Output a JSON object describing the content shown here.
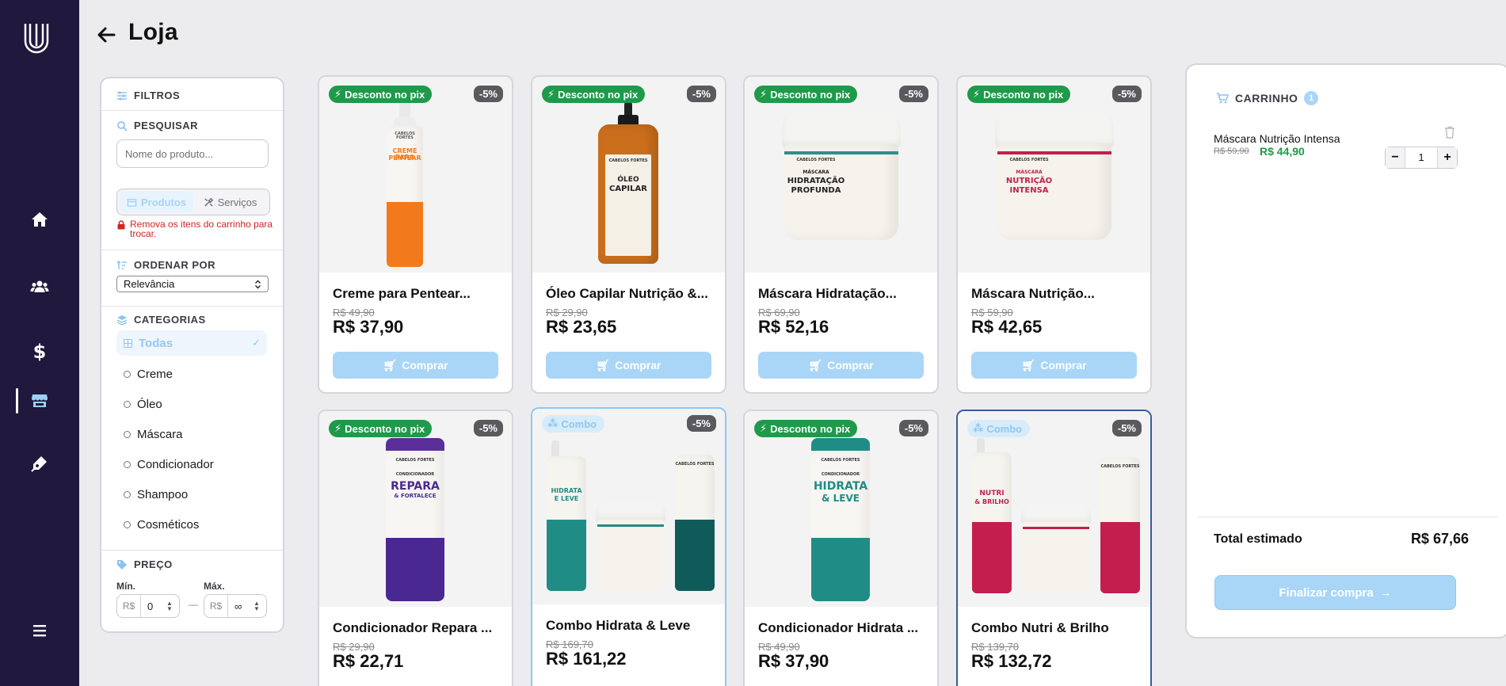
{
  "header": {
    "title": "Loja"
  },
  "sidebar": {
    "items": [
      {
        "name": "home",
        "icon": "home-icon"
      },
      {
        "name": "users",
        "icon": "users-icon"
      },
      {
        "name": "finance",
        "icon": "dollar-icon",
        "glyph": "$"
      },
      {
        "name": "store",
        "icon": "store-icon",
        "active": true
      },
      {
        "name": "tools",
        "icon": "pen-icon"
      },
      {
        "name": "menu",
        "icon": "menu-icon"
      }
    ]
  },
  "filters": {
    "title": "FILTROS",
    "search_title": "PESQUISAR",
    "search_placeholder": "Nome do produto...",
    "toggle": {
      "products": "Produtos",
      "services": "Serviços",
      "selected": "Produtos"
    },
    "warning": "Remova os itens do carrinho para trocar.",
    "sort_title": "ORDENAR POR",
    "sort_value": "Relevância",
    "categories_title": "CATEGORIAS",
    "categories": [
      "Todas",
      "Creme",
      "Óleo",
      "Máscara",
      "Condicionador",
      "Shampoo",
      "Cosméticos"
    ],
    "active_category": "Todas",
    "price_title": "PREÇO",
    "min_label": "Mín.",
    "max_label": "Máx.",
    "currency": "R$",
    "min_value": "0",
    "max_value": "∞",
    "range_sep": "—"
  },
  "products": [
    {
      "name": "Creme para Pentear...",
      "old_price": "R$ 49,90",
      "price": "R$ 37,90",
      "badge": "Desconto no pix",
      "discount": "-5%",
      "buy": "Comprar"
    },
    {
      "name": "Óleo Capilar Nutrição &...",
      "old_price": "R$ 29,90",
      "price": "R$ 23,65",
      "badge": "Desconto no pix",
      "discount": "-5%",
      "buy": "Comprar"
    },
    {
      "name": "Máscara Hidratação...",
      "old_price": "R$ 69,90",
      "price": "R$ 52,16",
      "badge": "Desconto no pix",
      "discount": "-5%",
      "buy": "Comprar"
    },
    {
      "name": "Máscara Nutrição...",
      "old_price": "R$ 59,90",
      "price": "R$ 42,65",
      "badge": "Desconto no pix",
      "discount": "-5%",
      "buy": "Comprar"
    },
    {
      "name": "Condicionador Repara ...",
      "old_price": "R$ 29,90",
      "price": "R$ 22,71",
      "badge": "Desconto no pix",
      "discount": "-5%"
    },
    {
      "name": "Combo Hidrata & Leve",
      "old_price": "R$ 169,70",
      "price": "R$ 161,22",
      "badge": "Combo",
      "discount": "-5%"
    },
    {
      "name": "Condicionador Hidrata ...",
      "old_price": "R$ 49,90",
      "price": "R$ 37,90",
      "badge": "Desconto no pix",
      "discount": "-5%"
    },
    {
      "name": "Combo Nutri & Brilho",
      "old_price": "R$ 139,70",
      "price": "R$ 132,72",
      "badge": "Combo",
      "discount": "-5%"
    }
  ],
  "cart": {
    "title": "CARRINHO",
    "count": "1",
    "item": {
      "name": "Máscara Nutrição Intensa",
      "old_price": "R$ 59,90",
      "price": "R$ 44,90",
      "qty": "1",
      "minus": "−",
      "plus": "+"
    },
    "total_label": "Total estimado",
    "total_value": "R$ 67,66",
    "checkout": "Finalizar compra"
  },
  "label_texts": {
    "p1": {
      "brand": "CABELOS FORTES",
      "line1": "CREME PARA",
      "line2": "PENTEAR"
    },
    "p2": {
      "brand": "CABELOS FORTES",
      "line1": "ÓLEO",
      "line2": "CAPILAR"
    },
    "p3": {
      "brand": "CABELOS FORTES",
      "line1": "MÁSCARA",
      "line2": "HIDRATAÇÃO",
      "line3": "PROFUNDA"
    },
    "p4": {
      "brand": "CABELOS FORTES",
      "line1": "MÁSCARA",
      "line2": "NUTRIÇÃO",
      "line3": "INTENSA"
    },
    "p5": {
      "brand": "CABELOS FORTES",
      "line1": "CONDICIONADOR",
      "line2": "REPARA",
      "line3": "& FORTALECE"
    },
    "p6": {
      "brand": "CABELOS FORTES",
      "line1": "HIDRATA",
      "line2": "E LEVE"
    },
    "p7": {
      "brand": "CABELOS FORTES",
      "line1": "CONDICIONADOR",
      "line2": "HIDRATA",
      "line3": "& LEVE"
    },
    "p8": {
      "brand": "CABELOS FORTES",
      "line1": "NUTRI",
      "line2": "& BRILHO"
    }
  },
  "colors": {
    "sidebar": "#21183d",
    "accent_light": "#a9d6f7",
    "pix_green": "#1e9a4a",
    "warning_red": "#d12424",
    "discount_gray": "#5a5a5e"
  }
}
